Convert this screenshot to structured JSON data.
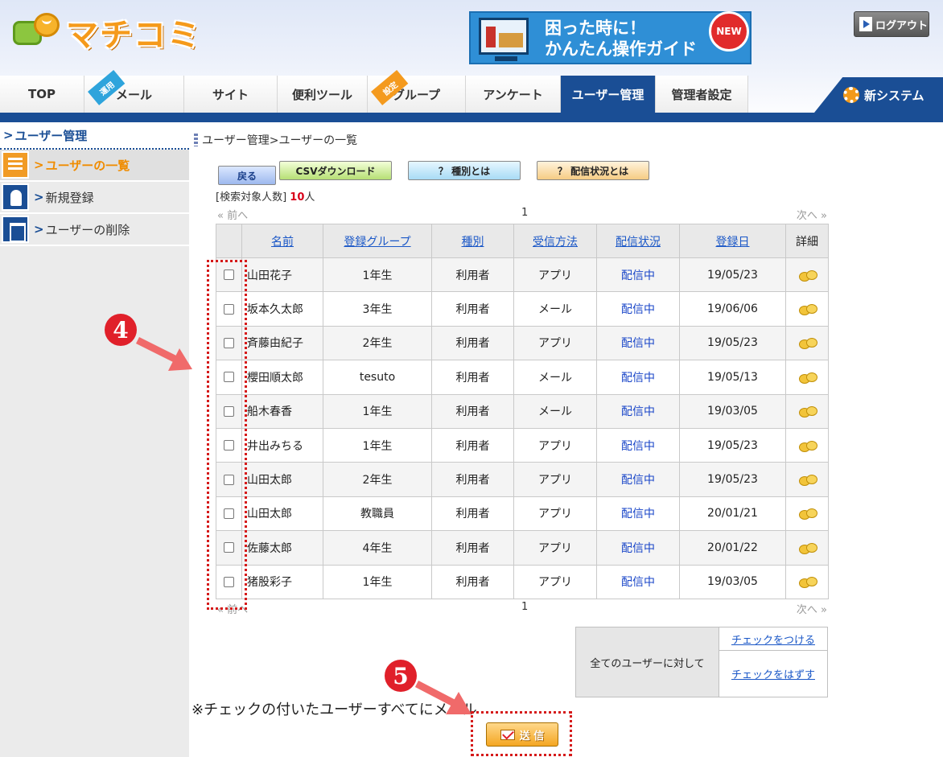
{
  "header": {
    "logo_text": "マチコミ",
    "guide_line1": "困った時に！",
    "guide_line2": "かんたん操作ガイド",
    "guide_badge": "NEW",
    "logout_label": "ログアウト",
    "new_system_label": "新システム"
  },
  "nav": {
    "tabs": [
      {
        "label": "TOP"
      },
      {
        "label": "メール",
        "tag": "運用"
      },
      {
        "label": "サイト"
      },
      {
        "label": "便利ツール"
      },
      {
        "label": "グループ",
        "tag": "設定"
      },
      {
        "label": "アンケート"
      },
      {
        "label": "ユーザー管理",
        "active": true
      },
      {
        "label": "管理者設定"
      }
    ]
  },
  "sidebar": {
    "title": "ユーザー管理",
    "items": [
      {
        "label": "ユーザーの一覧",
        "active": true,
        "icon": "user-list-icon"
      },
      {
        "label": "新規登録",
        "icon": "add-user-icon"
      },
      {
        "label": "ユーザーの削除",
        "icon": "trash-icon"
      }
    ]
  },
  "breadcrumb": "ユーザー管理>ユーザーの一覧",
  "toolbar": {
    "back": "戻る",
    "csv": "CSVダウンロード",
    "type_help": "？ 種別とは",
    "status_help": "？ 配信状況とは"
  },
  "count": {
    "prefix": "[検索対象人数]",
    "value": "10",
    "suffix": "人"
  },
  "pager": {
    "prev": "前へ",
    "page": "1",
    "next": "次へ"
  },
  "table": {
    "headers": [
      "名前",
      "登録グループ",
      "種別",
      "受信方法",
      "配信状況",
      "登録日",
      "詳細"
    ],
    "rows": [
      {
        "name": "山田花子",
        "group": "1年生",
        "type": "利用者",
        "method": "アプリ",
        "status": "配信中",
        "date": "19/05/23"
      },
      {
        "name": "坂本久太郎",
        "group": "3年生",
        "type": "利用者",
        "method": "メール",
        "status": "配信中",
        "date": "19/06/06"
      },
      {
        "name": "斉藤由紀子",
        "group": "2年生",
        "type": "利用者",
        "method": "アプリ",
        "status": "配信中",
        "date": "19/05/23"
      },
      {
        "name": "櫻田順太郎",
        "group": "tesuto",
        "type": "利用者",
        "method": "メール",
        "status": "配信中",
        "date": "19/05/13"
      },
      {
        "name": "船木春香",
        "group": "1年生",
        "type": "利用者",
        "method": "メール",
        "status": "配信中",
        "date": "19/03/05"
      },
      {
        "name": "井出みちる",
        "group": "1年生",
        "type": "利用者",
        "method": "アプリ",
        "status": "配信中",
        "date": "19/05/23"
      },
      {
        "name": "山田太郎",
        "group": "2年生",
        "type": "利用者",
        "method": "アプリ",
        "status": "配信中",
        "date": "19/05/23"
      },
      {
        "name": "山田太郎",
        "group": "教職員",
        "type": "利用者",
        "method": "アプリ",
        "status": "配信中",
        "date": "20/01/21"
      },
      {
        "name": "佐藤太郎",
        "group": "4年生",
        "type": "利用者",
        "method": "アプリ",
        "status": "配信中",
        "date": "20/01/22"
      },
      {
        "name": "猪股彩子",
        "group": "1年生",
        "type": "利用者",
        "method": "アプリ",
        "status": "配信中",
        "date": "19/03/05"
      }
    ]
  },
  "check_all": {
    "label": "全てのユーザーに対して",
    "check": "チェックをつける",
    "uncheck": "チェックをはずす"
  },
  "note": "※チェックの付いたユーザーすべてにメール",
  "send_label": "送 信",
  "callouts": {
    "four": "4",
    "five": "5"
  },
  "colors": {
    "accent_blue": "#1a4e95",
    "accent_orange": "#f08c00",
    "callout_red": "#e0202a"
  }
}
